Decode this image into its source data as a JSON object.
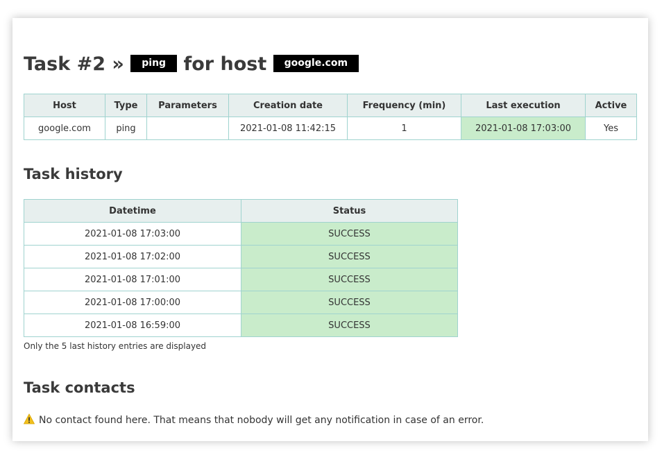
{
  "header": {
    "title_prefix": "Task #2 »",
    "type_tag": "ping",
    "title_middle": "for host",
    "host_tag": "google.com"
  },
  "task_table": {
    "columns": [
      "Host",
      "Type",
      "Parameters",
      "Creation date",
      "Frequency (min)",
      "Last execution",
      "Active"
    ],
    "row": {
      "host": "google.com",
      "type": "ping",
      "parameters": "",
      "creation_date": "2021-01-08 11:42:15",
      "frequency": "1",
      "last_execution": "2021-01-08 17:03:00",
      "active": "Yes"
    }
  },
  "history": {
    "title": "Task history",
    "columns": [
      "Datetime",
      "Status"
    ],
    "rows": [
      {
        "datetime": "2021-01-08 17:03:00",
        "status": "SUCCESS"
      },
      {
        "datetime": "2021-01-08 17:02:00",
        "status": "SUCCESS"
      },
      {
        "datetime": "2021-01-08 17:01:00",
        "status": "SUCCESS"
      },
      {
        "datetime": "2021-01-08 17:00:00",
        "status": "SUCCESS"
      },
      {
        "datetime": "2021-01-08 16:59:00",
        "status": "SUCCESS"
      }
    ],
    "note": "Only the 5 last history entries are displayed"
  },
  "contacts": {
    "title": "Task contacts",
    "icon": "warning-icon",
    "message": "No contact found here. That means that nobody will get any notification in case of an error."
  },
  "colors": {
    "success_bg": "#c9eccb",
    "header_bg": "#e7efee",
    "border": "#9fd3cf",
    "tag_bg": "#000000"
  }
}
